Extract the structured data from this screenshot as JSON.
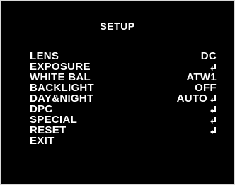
{
  "title": "SETUP",
  "menu": [
    {
      "label": "LENS",
      "value": "DC",
      "icon": ""
    },
    {
      "label": "EXPOSURE",
      "value": "",
      "icon": "enter-icon"
    },
    {
      "label": "WHITE BAL",
      "value": "ATW1",
      "icon": ""
    },
    {
      "label": "BACKLIGHT",
      "value": "OFF",
      "icon": ""
    },
    {
      "label": "DAY&NIGHT",
      "value": "AUTO",
      "icon": "enter-icon"
    },
    {
      "label": "DPC",
      "value": "",
      "icon": "enter-icon"
    },
    {
      "label": "SPECIAL",
      "value": "",
      "icon": "enter-icon"
    },
    {
      "label": "RESET",
      "value": "",
      "icon": "enter-icon"
    },
    {
      "label": "EXIT",
      "value": "",
      "icon": ""
    }
  ],
  "colors": {
    "background": "#000000",
    "text": "#ffffff",
    "border": "#d8d8d8"
  }
}
